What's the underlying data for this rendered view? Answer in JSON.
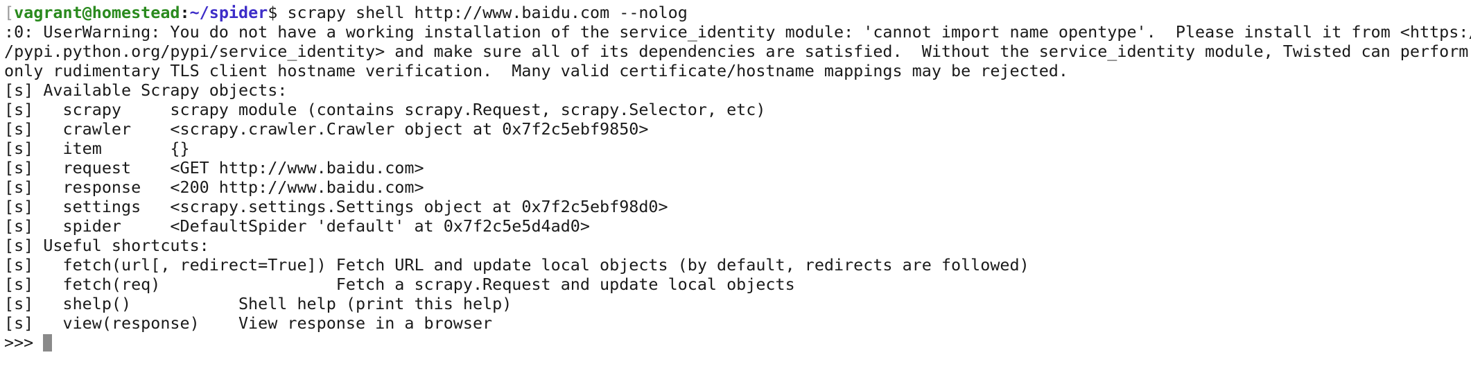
{
  "prompt": {
    "bracket": "[",
    "user_host": "vagrant@homestead",
    "separator": ":",
    "path": "~/spider",
    "dollar": "$",
    "command": " scrapy shell http://www.baidu.com --nolog"
  },
  "output": [
    ":0: UserWarning: You do not have a working installation of the service_identity module: 'cannot import name opentype'.  Please install it from <https:/",
    "/pypi.python.org/pypi/service_identity> and make sure all of its dependencies are satisfied.  Without the service_identity module, Twisted can perform",
    "only rudimentary TLS client hostname verification.  Many valid certificate/hostname mappings may be rejected.",
    "[s] Available Scrapy objects:",
    "[s]   scrapy     scrapy module (contains scrapy.Request, scrapy.Selector, etc)",
    "[s]   crawler    <scrapy.crawler.Crawler object at 0x7f2c5ebf9850>",
    "[s]   item       {}",
    "[s]   request    <GET http://www.baidu.com>",
    "[s]   response   <200 http://www.baidu.com>",
    "[s]   settings   <scrapy.settings.Settings object at 0x7f2c5ebf98d0>",
    "[s]   spider     <DefaultSpider 'default' at 0x7f2c5e5d4ad0>",
    "[s] Useful shortcuts:",
    "[s]   fetch(url[, redirect=True]) Fetch URL and update local objects (by default, redirects are followed)",
    "[s]   fetch(req)                  Fetch a scrapy.Request and update local objects",
    "[s]   shelp()           Shell help (print this help)",
    "[s]   view(response)    View response in a browser"
  ],
  "repl_prompt": ">>> "
}
